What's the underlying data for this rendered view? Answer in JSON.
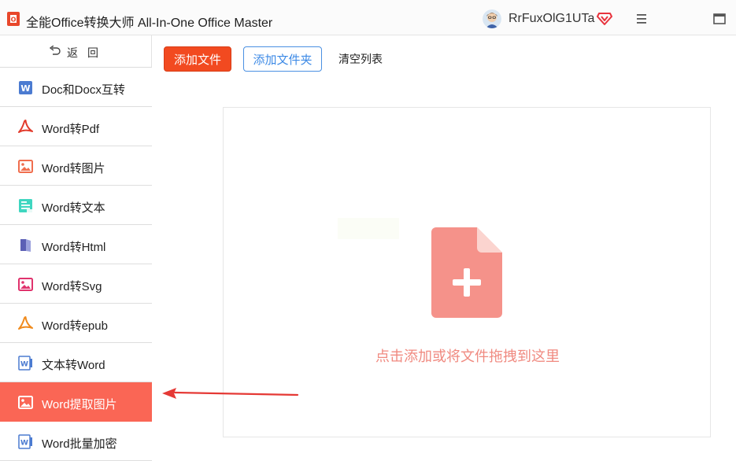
{
  "window": {
    "title": "全能Office转换大师 All-In-One Office Master",
    "username": "RrFuxOlG1UTa",
    "icons": {
      "logo": "office-logo-icon",
      "avatar": "user-avatar",
      "vip": "vip-diamond-icon",
      "menu": "hamburger-menu-icon",
      "maximize": "maximize-window-icon"
    }
  },
  "sidebar": {
    "back_label": "返回",
    "items": [
      {
        "label": "Doc和Docx互转",
        "icon": "word-doc-icon",
        "active": false
      },
      {
        "label": "Word转Pdf",
        "icon": "pdf-icon",
        "active": false
      },
      {
        "label": "Word转图片",
        "icon": "image-icon",
        "active": false
      },
      {
        "label": "Word转文本",
        "icon": "text-file-icon",
        "active": false
      },
      {
        "label": "Word转Html",
        "icon": "html-book-icon",
        "active": false
      },
      {
        "label": "Word转Svg",
        "icon": "svg-image-icon",
        "active": false
      },
      {
        "label": "Word转epub",
        "icon": "epub-icon",
        "active": false
      },
      {
        "label": "文本转Word",
        "icon": "word-outline-icon",
        "active": false
      },
      {
        "label": "Word提取图片",
        "icon": "extract-image-icon",
        "active": true
      },
      {
        "label": "Word批量加密",
        "icon": "word-lock-icon",
        "active": false
      }
    ]
  },
  "toolbar": {
    "add_file": "添加文件",
    "add_folder": "添加文件夹",
    "clear_list": "清空列表"
  },
  "dropzone": {
    "hint": "点击添加或将文件拖拽到这里",
    "icon": "file-add-icon"
  },
  "colors": {
    "accent": "#fa6655",
    "primary_button": "#f24a20",
    "secondary_button_text": "#3d8ae6",
    "drop_icon": "#f5928a",
    "annotation_arrow": "#e53935"
  }
}
